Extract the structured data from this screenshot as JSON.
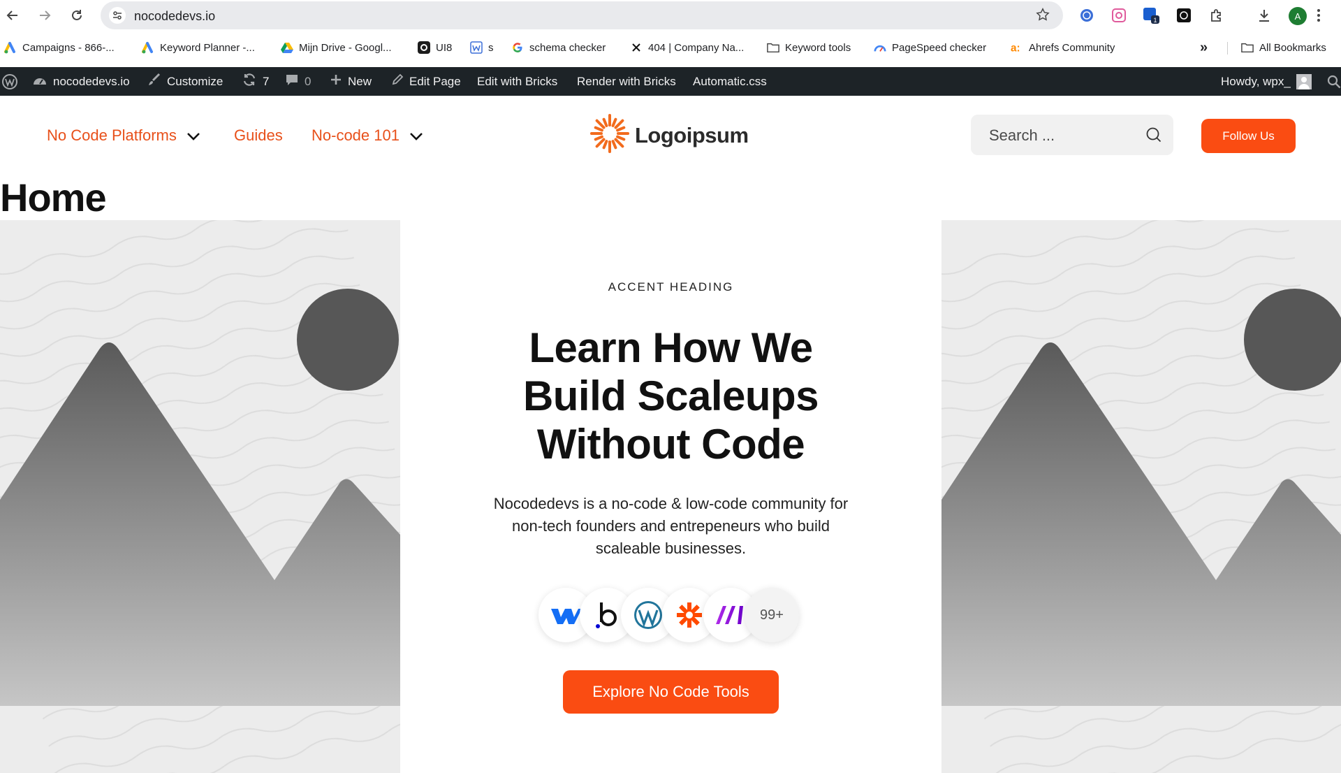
{
  "browser": {
    "url": "nocodedevs.io",
    "avatar_letter": "A",
    "ext_badge": "1",
    "bookmarks": [
      {
        "label": "Campaigns - 866-...",
        "icon": "google-ads-icon"
      },
      {
        "label": "Keyword Planner -...",
        "icon": "google-ads-icon"
      },
      {
        "label": "Mijn Drive - Googl...",
        "icon": "google-drive-icon"
      },
      {
        "label": "UI8",
        "icon": "ui8-icon"
      },
      {
        "label": "s",
        "icon": "w-icon"
      },
      {
        "label": "schema checker",
        "icon": "google-icon"
      },
      {
        "label": "404 | Company Na...",
        "icon": "x-icon"
      },
      {
        "label": "Keyword tools",
        "icon": "folder-icon"
      },
      {
        "label": "PageSpeed checker",
        "icon": "pagespeed-icon"
      },
      {
        "label": "Ahrefs Community",
        "icon": "ahrefs-icon"
      }
    ],
    "all_bookmarks": "All Bookmarks",
    "overflow": "»"
  },
  "adminbar": {
    "site": "nocodedevs.io",
    "customize": "Customize",
    "updates": "7",
    "comments": "0",
    "new": "New",
    "edit_page": "Edit Page",
    "edit_bricks": "Edit with Bricks",
    "render_bricks": "Render with Bricks",
    "automatic": "Automatic.css",
    "howdy": "Howdy, wpx_"
  },
  "header": {
    "nav": [
      {
        "label": "No Code Platforms",
        "dropdown": true
      },
      {
        "label": "Guides",
        "dropdown": false
      },
      {
        "label": "No-code 101",
        "dropdown": true
      }
    ],
    "logo_text": "Logoipsum",
    "search_placeholder": "Search ...",
    "follow_label": "Follow Us"
  },
  "page_title": "Home",
  "hero": {
    "accent": "ACCENT HEADING",
    "headline": [
      "Learn How We",
      "Build Scaleups",
      "Without Code"
    ],
    "description": "Nocodedevs is a no-code & low-code community for non-tech founders and entrepeneurs who build scaleable businesses.",
    "tools": [
      "webflow-icon",
      "bubble-icon",
      "wordpress-icon",
      "zapier-icon",
      "make-icon"
    ],
    "tools_more": "99+",
    "cta": "Explore No Code Tools"
  },
  "colors": {
    "accent": "#fa4c12",
    "nav_link": "#e8501a",
    "adminbar": "#1d2327"
  }
}
